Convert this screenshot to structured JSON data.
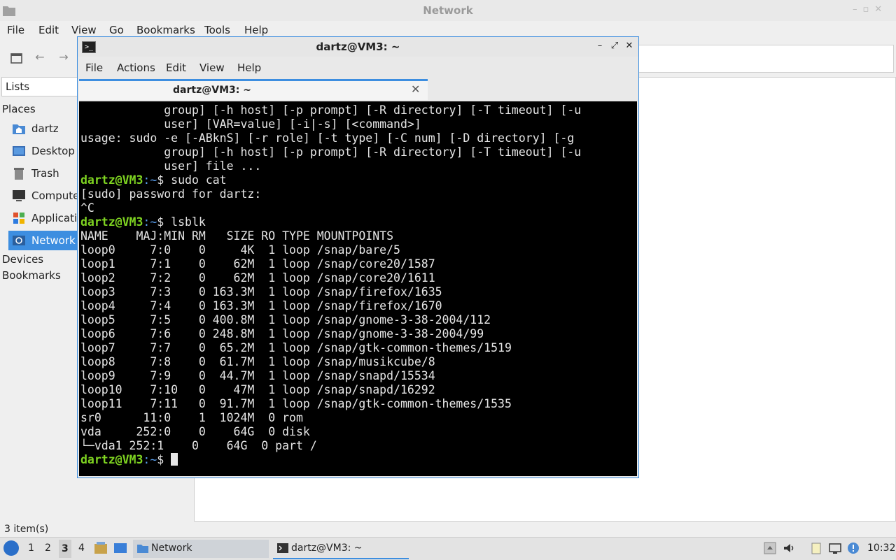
{
  "file_manager": {
    "window_title": "Network",
    "menu": [
      "File",
      "Edit",
      "View",
      "Go",
      "Bookmarks",
      "Tools",
      "Help"
    ],
    "sidebar": {
      "combo_value": "Lists",
      "places_heading": "Places",
      "places": [
        {
          "label": "dartz",
          "icon": "home-folder-icon"
        },
        {
          "label": "Desktop",
          "icon": "desktop-icon"
        },
        {
          "label": "Trash",
          "icon": "trash-icon"
        },
        {
          "label": "Computer",
          "icon": "computer-icon"
        },
        {
          "label": "Applications",
          "icon": "applications-icon"
        },
        {
          "label": "Network",
          "icon": "network-icon",
          "selected": true
        }
      ],
      "devices_heading": "Devices",
      "bookmarks_heading": "Bookmarks"
    },
    "status": "3 item(s)"
  },
  "terminal": {
    "window_title": "dartz@VM3: ~",
    "menu": [
      "File",
      "Actions",
      "Edit",
      "View",
      "Help"
    ],
    "tab_label": "dartz@VM3: ~",
    "prompt_user": "dartz@VM3",
    "lines": [
      {
        "type": "out",
        "text": "            group] [-h host] [-p prompt] [-R directory] [-T timeout] [-u"
      },
      {
        "type": "out",
        "text": "            user] [VAR=value] [-i|-s] [<command>]"
      },
      {
        "type": "out",
        "text": "usage: sudo -e [-ABknS] [-r role] [-t type] [-C num] [-D directory] [-g"
      },
      {
        "type": "out",
        "text": "            group] [-h host] [-p prompt] [-R directory] [-T timeout] [-u"
      },
      {
        "type": "out",
        "text": "            user] file ..."
      },
      {
        "type": "cmd",
        "prompt": "dartz@VM3",
        "path": ":~",
        "text": "$ sudo cat"
      },
      {
        "type": "out",
        "text": "[sudo] password for dartz:"
      },
      {
        "type": "out",
        "text": "^C"
      },
      {
        "type": "cmd",
        "prompt": "dartz@VM3",
        "path": ":~",
        "text": "$ lsblk"
      },
      {
        "type": "out",
        "text": "NAME    MAJ:MIN RM   SIZE RO TYPE MOUNTPOINTS"
      },
      {
        "type": "out",
        "text": "loop0     7:0    0     4K  1 loop /snap/bare/5"
      },
      {
        "type": "out",
        "text": "loop1     7:1    0    62M  1 loop /snap/core20/1587"
      },
      {
        "type": "out",
        "text": "loop2     7:2    0    62M  1 loop /snap/core20/1611"
      },
      {
        "type": "out",
        "text": "loop3     7:3    0 163.3M  1 loop /snap/firefox/1635"
      },
      {
        "type": "out",
        "text": "loop4     7:4    0 163.3M  1 loop /snap/firefox/1670"
      },
      {
        "type": "out",
        "text": "loop5     7:5    0 400.8M  1 loop /snap/gnome-3-38-2004/112"
      },
      {
        "type": "out",
        "text": "loop6     7:6    0 248.8M  1 loop /snap/gnome-3-38-2004/99"
      },
      {
        "type": "out",
        "text": "loop7     7:7    0  65.2M  1 loop /snap/gtk-common-themes/1519"
      },
      {
        "type": "out",
        "text": "loop8     7:8    0  61.7M  1 loop /snap/musikcube/8"
      },
      {
        "type": "out",
        "text": "loop9     7:9    0  44.7M  1 loop /snap/snapd/15534"
      },
      {
        "type": "out",
        "text": "loop10    7:10   0    47M  1 loop /snap/snapd/16292"
      },
      {
        "type": "out",
        "text": "loop11    7:11   0  91.7M  1 loop /snap/gtk-common-themes/1535"
      },
      {
        "type": "out",
        "text": "sr0      11:0    1  1024M  0 rom"
      },
      {
        "type": "out",
        "text": "vda     252:0    0    64G  0 disk"
      },
      {
        "type": "out",
        "text": "└─vda1 252:1    0    64G  0 part /"
      },
      {
        "type": "cmd",
        "prompt": "dartz@VM3",
        "path": ":~",
        "text": "$ ",
        "cursor": true
      }
    ]
  },
  "taskbar": {
    "workspaces": [
      "1",
      "2",
      "3",
      "4"
    ],
    "active_workspace": "3",
    "tasks": [
      {
        "label": "Network",
        "icon": "folder-icon"
      },
      {
        "label": "dartz@VM3: ~",
        "icon": "terminal-icon"
      }
    ],
    "clock": "10:32"
  },
  "colors": {
    "accent": "#3d8ee0",
    "prompt_green": "#7ed321",
    "terminal_bg": "#000000"
  }
}
